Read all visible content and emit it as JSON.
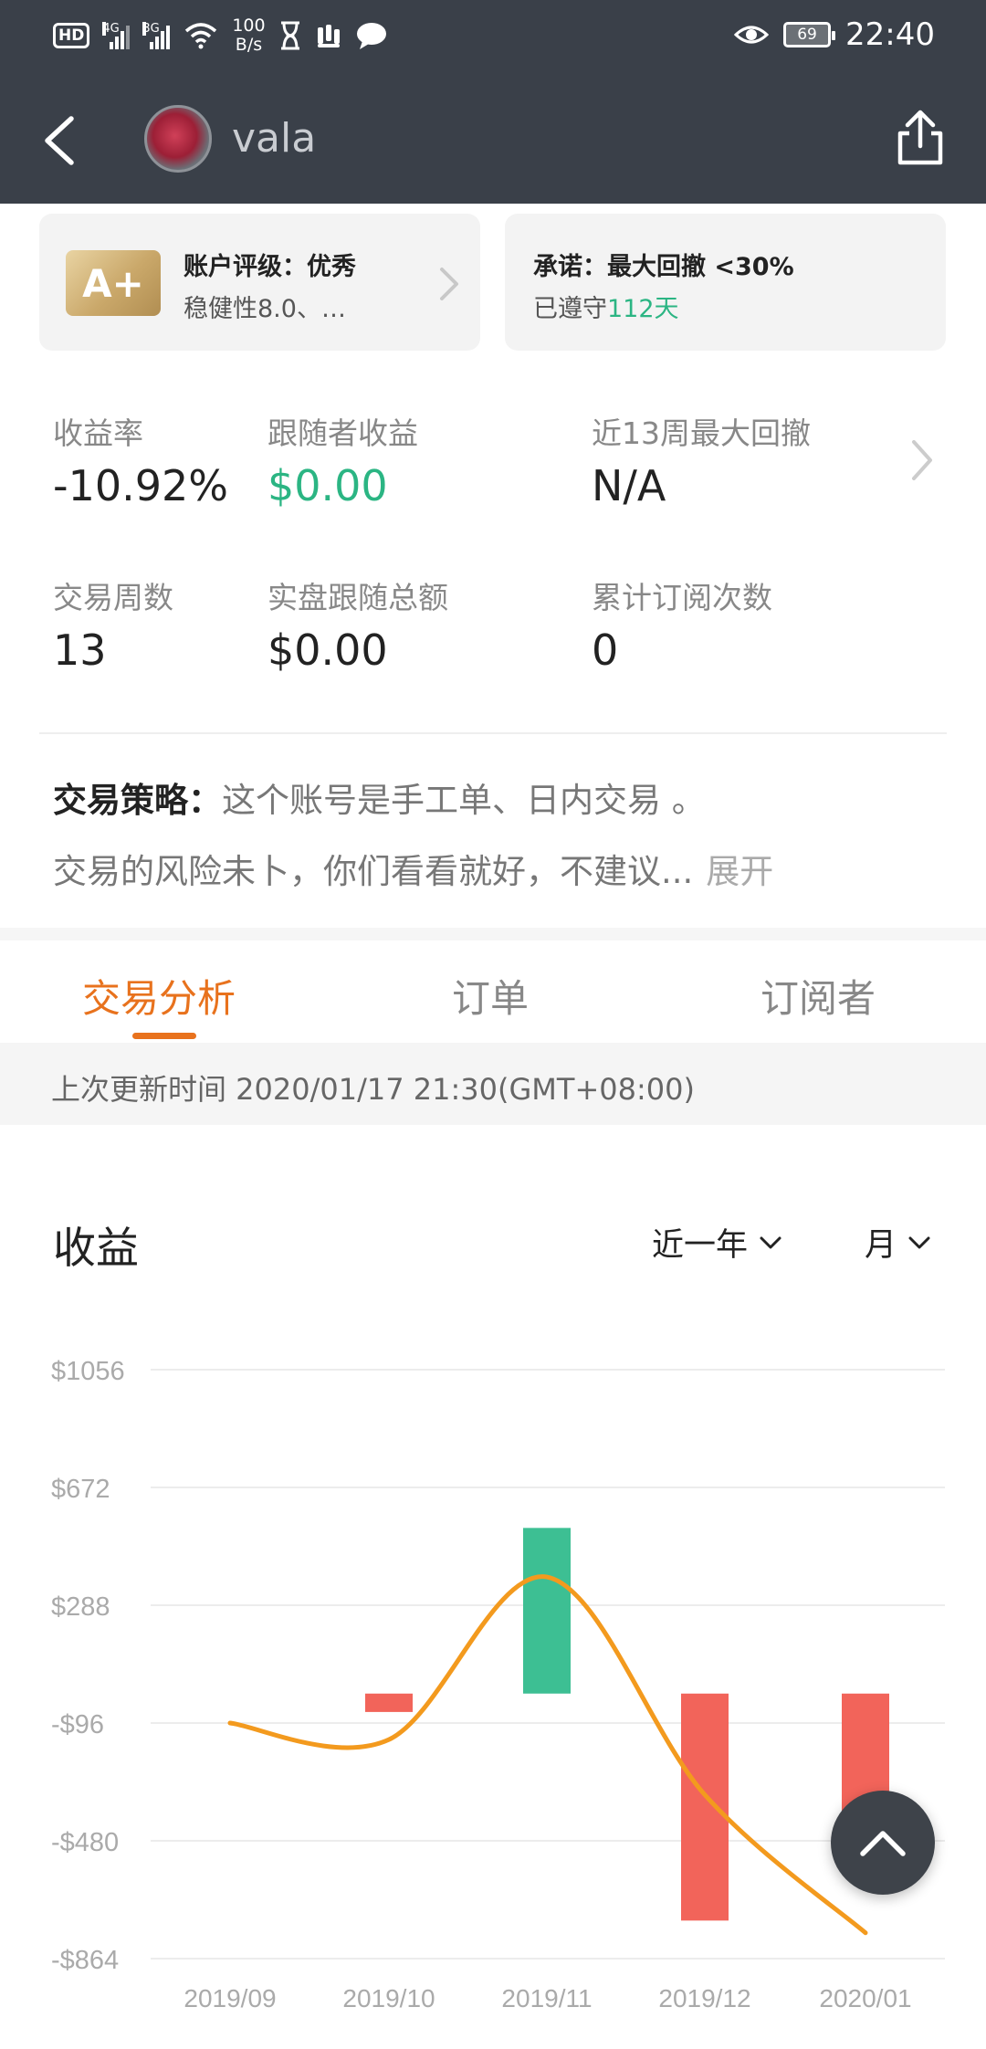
{
  "status_bar": {
    "network_label": "HD",
    "sim1": "4G",
    "sim2": "3G",
    "speed_value": "100",
    "speed_unit": "B/s",
    "battery": "69",
    "time": "22:40"
  },
  "header": {
    "name": "vala"
  },
  "rating_card": {
    "badge": "A+",
    "title": "账户评级：优秀",
    "subtitle": "稳健性8.0、…"
  },
  "promise_card": {
    "title": "承诺：最大回撤 <30%",
    "kept_prefix": "已遵守",
    "kept_value": "112天"
  },
  "stats": [
    {
      "label": "收益率",
      "value": "-10.92%"
    },
    {
      "label": "跟随者收益",
      "value": "$0.00"
    },
    {
      "label": "近13周最大回撤",
      "value": "N/A"
    },
    {
      "label": "交易周数",
      "value": "13"
    },
    {
      "label": "实盘跟随总额",
      "value": "$0.00"
    },
    {
      "label": "累计订阅次数",
      "value": "0"
    }
  ],
  "strategy": {
    "title": "交易策略：",
    "line1": "这个账号是手工单、日内交易 。",
    "line2": "交易的风险未卜，你们看看就好，不建议...",
    "expand": "展开"
  },
  "tabs": [
    {
      "label": "交易分析",
      "active": true
    },
    {
      "label": "订单",
      "active": false
    },
    {
      "label": "订阅者",
      "active": false
    }
  ],
  "update_text": "上次更新时间 2020/01/17 21:30(GMT+08:00)",
  "chart_section": {
    "title": "收益",
    "range_dropdown": "近一年",
    "period_dropdown": "月"
  },
  "colors": {
    "positive": "#3dbf93",
    "negative": "#f2645a",
    "line": "#f39a1e",
    "accent": "#e8721d"
  },
  "chart_data": {
    "type": "bar",
    "categories": [
      "2019/09",
      "2019/10",
      "2019/11",
      "2019/12",
      "2020/01"
    ],
    "series": [
      {
        "values": [
          0,
          -60,
          540,
          -740,
          -470
        ]
      },
      {
        "values": [
          -96,
          -150,
          380,
          -330,
          -780
        ]
      }
    ],
    "yticks": [
      "$1056",
      "$672",
      "$288",
      "-$96",
      "-$480",
      "-$864"
    ],
    "ytick_values": [
      1056,
      672,
      288,
      -96,
      -480,
      -864
    ],
    "ylim": [
      -864,
      1056
    ],
    "zero_value": 0,
    "grid": true
  },
  "icons": {
    "back": "chevron-left-icon",
    "share": "share-icon",
    "scroll_top": "chevron-up-icon"
  }
}
